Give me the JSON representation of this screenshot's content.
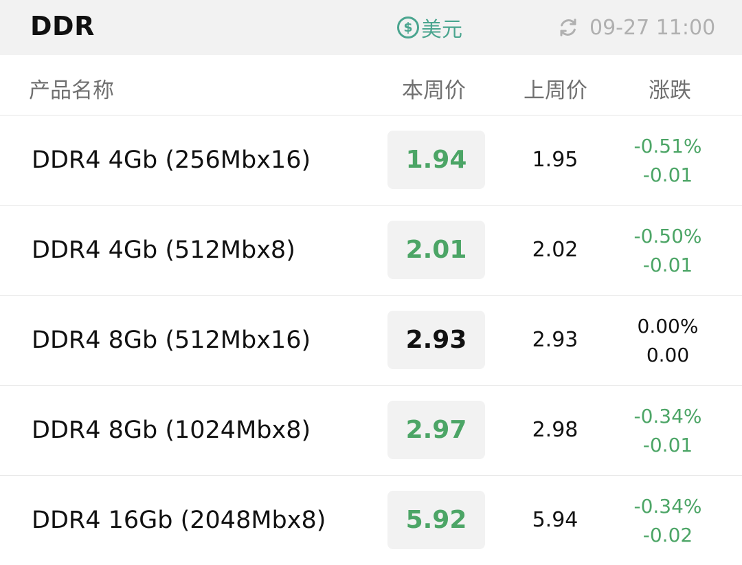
{
  "header": {
    "title": "DDR",
    "currency_symbol": "$",
    "currency_label": "美元",
    "timestamp": "09-27 11:00",
    "icons": {
      "currency": "dollar-circle-icon",
      "refresh": "refresh-icon"
    }
  },
  "columns": {
    "name": "产品名称",
    "this_week": "本周价",
    "last_week": "上周价",
    "change": "涨跌"
  },
  "colors": {
    "down": "#4ca566",
    "flat": "#111111",
    "accent": "#4aa58f",
    "header_bg": "#f2f2f2"
  },
  "rows": [
    {
      "name": "DDR4 4Gb (256Mbx16)",
      "this_week": "1.94",
      "last_week": "1.95",
      "change_pct": "-0.51%",
      "change_abs": "-0.01",
      "trend": "down"
    },
    {
      "name": "DDR4 4Gb (512Mbx8)",
      "this_week": "2.01",
      "last_week": "2.02",
      "change_pct": "-0.50%",
      "change_abs": "-0.01",
      "trend": "down"
    },
    {
      "name": "DDR4 8Gb (512Mbx16)",
      "this_week": "2.93",
      "last_week": "2.93",
      "change_pct": "0.00%",
      "change_abs": "0.00",
      "trend": "flat"
    },
    {
      "name": "DDR4 8Gb (1024Mbx8)",
      "this_week": "2.97",
      "last_week": "2.98",
      "change_pct": "-0.34%",
      "change_abs": "-0.01",
      "trend": "down"
    },
    {
      "name": "DDR4 16Gb (2048Mbx8)",
      "this_week": "5.92",
      "last_week": "5.94",
      "change_pct": "-0.34%",
      "change_abs": "-0.02",
      "trend": "down"
    }
  ]
}
